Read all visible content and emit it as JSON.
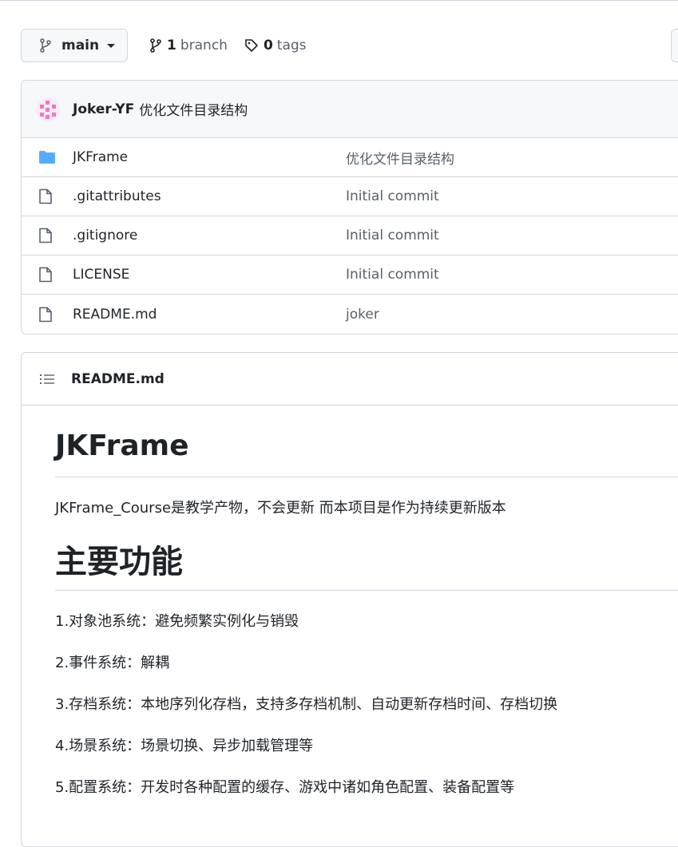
{
  "toolbar": {
    "branch": "main",
    "branch_count": "1",
    "branch_label": "branch",
    "tag_count": "0",
    "tag_label": "tags"
  },
  "commit": {
    "author": "Joker-YF",
    "message": "优化文件目录结构"
  },
  "files": [
    {
      "name": "JKFrame",
      "type": "folder",
      "message": "优化文件目录结构"
    },
    {
      "name": ".gitattributes",
      "type": "file",
      "message": "Initial commit"
    },
    {
      "name": ".gitignore",
      "type": "file",
      "message": "Initial commit"
    },
    {
      "name": "LICENSE",
      "type": "file",
      "message": "Initial commit"
    },
    {
      "name": "README.md",
      "type": "file",
      "message": "joker"
    }
  ],
  "readme": {
    "filename": "README.md",
    "title": "JKFrame",
    "intro": "JKFrame_Course是教学产物，不会更新 而本项目是作为持续更新版本",
    "section_title": "主要功能",
    "features": [
      "1.对象池系统：避免频繁实例化与销毁",
      "2.事件系统：解耦",
      "3.存档系统：本地序列化存档，支持多存档机制、自动更新存档时间、存档切换",
      "4.场景系统：场景切换、异步加载管理等",
      "5.配置系统：开发时各种配置的缓存、游戏中诸如角色配置、装备配置等"
    ]
  },
  "icons": {
    "folder_color": "#54aeff",
    "file_color": "#57606a"
  }
}
